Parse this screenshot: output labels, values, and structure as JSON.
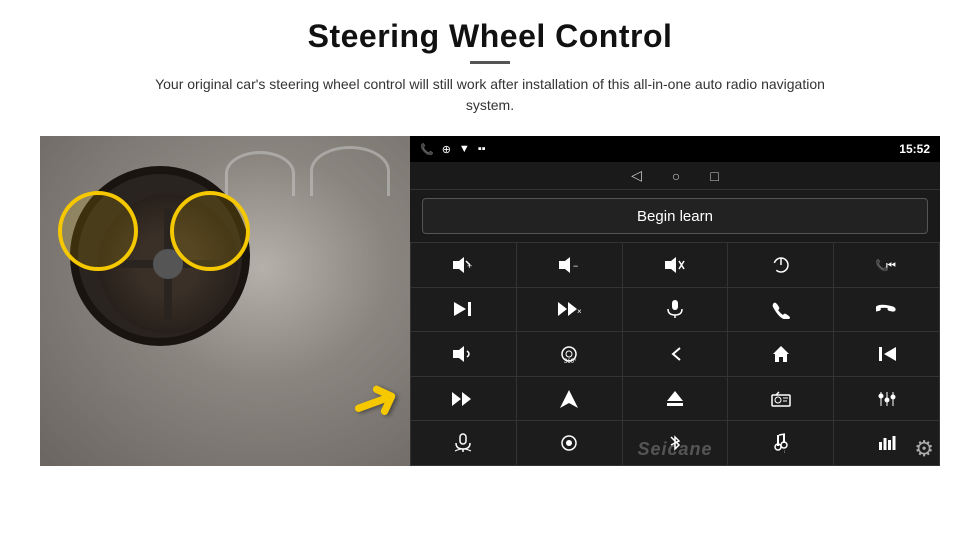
{
  "header": {
    "title": "Steering Wheel Control",
    "subtitle": "Your original car's steering wheel control will still work after installation of this all-in-one auto radio navigation system."
  },
  "status_bar": {
    "time": "15:52",
    "icons": [
      "phone",
      "location",
      "wifi",
      "battery"
    ]
  },
  "begin_learn": {
    "label": "Begin learn"
  },
  "nav_icons": [
    "back",
    "home",
    "square"
  ],
  "control_buttons": [
    {
      "icon": "🔊+",
      "name": "volume-up"
    },
    {
      "icon": "🔊−",
      "name": "volume-down"
    },
    {
      "icon": "🔇",
      "name": "mute"
    },
    {
      "icon": "⏻",
      "name": "power"
    },
    {
      "icon": "📞⏮",
      "name": "phone-prev"
    },
    {
      "icon": "⏭",
      "name": "next-track"
    },
    {
      "icon": "⏭×",
      "name": "skip-fast"
    },
    {
      "icon": "🎙",
      "name": "microphone"
    },
    {
      "icon": "📞",
      "name": "phone"
    },
    {
      "icon": "↩",
      "name": "hang-up"
    },
    {
      "icon": "📢",
      "name": "horn"
    },
    {
      "icon": "🔁360",
      "name": "camera-360"
    },
    {
      "icon": "↩",
      "name": "back-nav"
    },
    {
      "icon": "🏠",
      "name": "home-nav"
    },
    {
      "icon": "⏮⏮",
      "name": "prev-track"
    },
    {
      "icon": "⏭⏭",
      "name": "fast-forward"
    },
    {
      "icon": "▶",
      "name": "navigate"
    },
    {
      "icon": "⏏",
      "name": "eject"
    },
    {
      "icon": "📻",
      "name": "radio"
    },
    {
      "icon": "🎛",
      "name": "equalizer"
    },
    {
      "icon": "🎤",
      "name": "mic2"
    },
    {
      "icon": "⚙",
      "name": "settings-knob"
    },
    {
      "icon": "✱",
      "name": "bluetooth"
    },
    {
      "icon": "🎵",
      "name": "music"
    },
    {
      "icon": "📊",
      "name": "levels"
    }
  ],
  "watermark": "Seicane",
  "gear_icon": "⚙"
}
